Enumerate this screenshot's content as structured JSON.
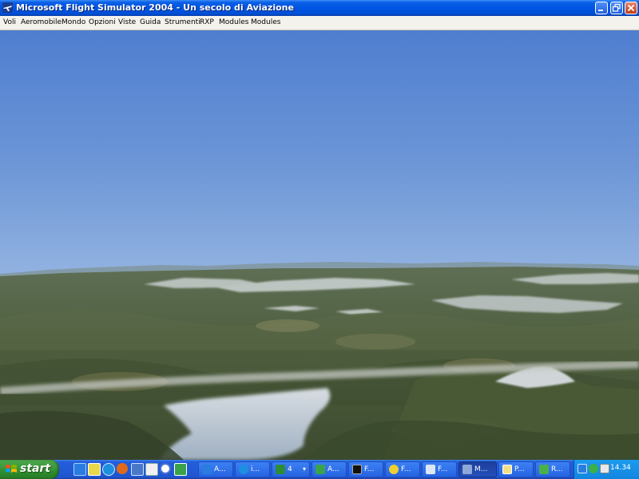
{
  "window": {
    "title": "Microsoft Flight Simulator 2004 - Un secolo di Aviazione",
    "app_icon": "plane-icon",
    "controls": [
      "minimize-icon",
      "restore-icon",
      "close-icon"
    ]
  },
  "menu": {
    "items": [
      "Voli",
      "Aeromobile",
      "Mondo",
      "Opzioni",
      "Viste",
      "Guida",
      "Strumenti",
      "RXP",
      "Modules",
      "Modules"
    ]
  },
  "scene": {
    "description_icon": "3d-flight-view",
    "sky_top_color": "#4f7ed0",
    "sky_horizon_color": "#b9cfe8",
    "terrain_color": "#4a5a3a"
  },
  "taskbar": {
    "start_label": "start",
    "quick_launch": [
      "ie-icon",
      "messenger-icon",
      "firefox-icon",
      "show-desktop-icon",
      "outlook-icon",
      "media-icon",
      "app-icon"
    ],
    "tasks": [
      {
        "label": "A...",
        "icon": "ie-icon"
      },
      {
        "label": "i...",
        "icon": "ie-icon"
      },
      {
        "label": "4",
        "icon": "excel-icon"
      },
      {
        "label": "A...",
        "icon": "app-icon"
      },
      {
        "label": "F...",
        "icon": "console-icon"
      },
      {
        "label": "F...",
        "icon": "app-icon"
      },
      {
        "label": "F...",
        "icon": "plane-icon"
      },
      {
        "label": "M...",
        "icon": "plane-icon"
      },
      {
        "label": "P...",
        "icon": "app-icon"
      },
      {
        "label": "R...",
        "icon": "app-icon"
      }
    ],
    "active_task_index": 7,
    "clock": "14.34"
  }
}
